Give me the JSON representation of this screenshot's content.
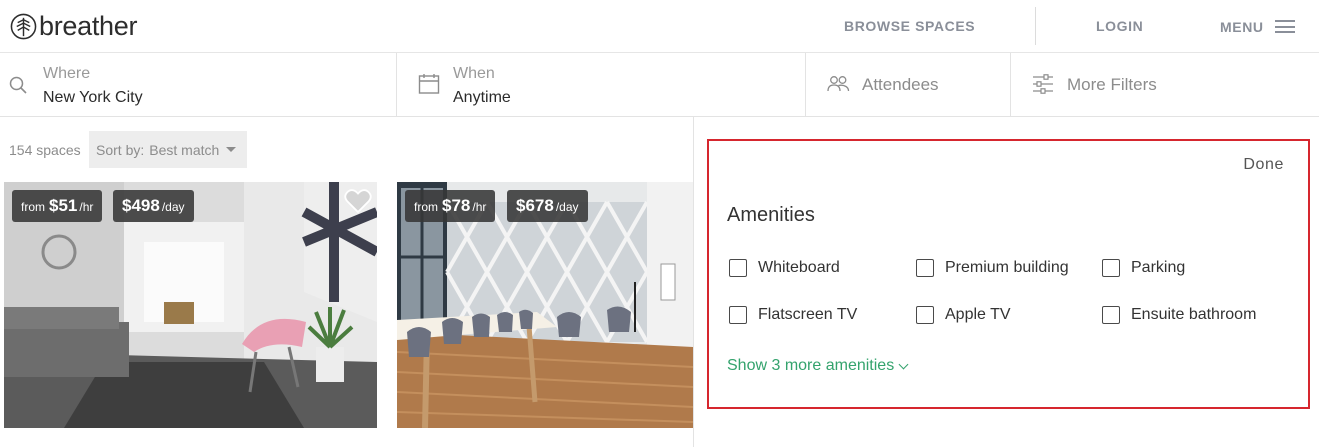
{
  "header": {
    "logo_text": "breather",
    "nav": {
      "browse": "BROWSE SPACES",
      "login": "LOGIN",
      "menu": "MENU"
    }
  },
  "search": {
    "where": {
      "label": "Where",
      "value": "New York City"
    },
    "when": {
      "label": "When",
      "value": "Anytime"
    },
    "attendees": {
      "label": "Attendees"
    },
    "more_filters": {
      "label": "More Filters"
    }
  },
  "results": {
    "count": "154 spaces",
    "sort_label": "Sort by:",
    "sort_value": "Best match",
    "cards": [
      {
        "hourly_from": "from",
        "hourly": "$51",
        "hourly_unit": "/hr",
        "daily": "$498",
        "daily_unit": "/day"
      },
      {
        "hourly_from": "from",
        "hourly": "$78",
        "hourly_unit": "/hr",
        "daily": "$678",
        "daily_unit": "/day"
      }
    ]
  },
  "filters_panel": {
    "done": "Done",
    "title": "Amenities",
    "amenities": [
      "Whiteboard",
      "Premium building",
      "Parking",
      "Flatscreen TV",
      "Apple TV",
      "Ensuite bathroom"
    ],
    "show_more": "Show 3 more amenities",
    "accent_color": "#34a36d",
    "highlight_color": "#d6262e"
  }
}
